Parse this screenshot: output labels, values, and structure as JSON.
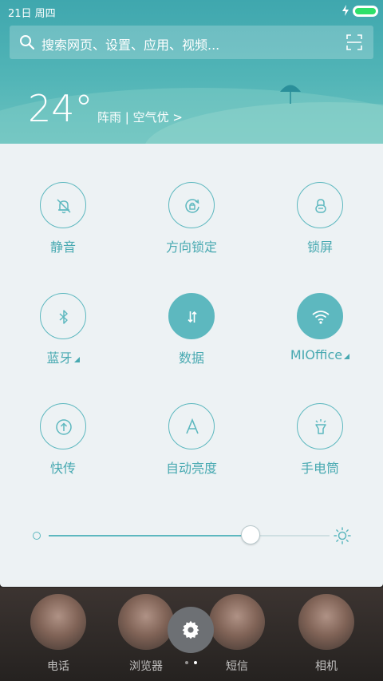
{
  "status_bar": {
    "time": "21日 周四"
  },
  "search": {
    "placeholder": "搜索网页、设置、应用、视频..."
  },
  "weather": {
    "temperature": "24°",
    "description": "阵雨 | 空气优 >"
  },
  "toggles": [
    {
      "label": "静音",
      "icon": "bell-off-icon",
      "on": false
    },
    {
      "label": "方向锁定",
      "icon": "rotation-lock-icon",
      "on": false
    },
    {
      "label": "锁屏",
      "icon": "lock-icon",
      "on": false
    },
    {
      "label": "蓝牙",
      "icon": "bluetooth-icon",
      "on": false
    },
    {
      "label": "数据",
      "icon": "data-arrows-icon",
      "on": true
    },
    {
      "label": "MIOffice",
      "icon": "wifi-icon",
      "on": true
    },
    {
      "label": "快传",
      "icon": "transfer-icon",
      "on": false
    },
    {
      "label": "自动亮度",
      "icon": "auto-brightness-icon",
      "on": false
    },
    {
      "label": "手电筒",
      "icon": "flashlight-icon",
      "on": false
    }
  ],
  "brightness": {
    "level": 0.72
  },
  "dock": {
    "apps": [
      "电话",
      "浏览器",
      "短信",
      "相机"
    ]
  },
  "colors": {
    "accent": "#5db8bf",
    "panel": "#edf2f4",
    "header": "#4fb1b4"
  }
}
